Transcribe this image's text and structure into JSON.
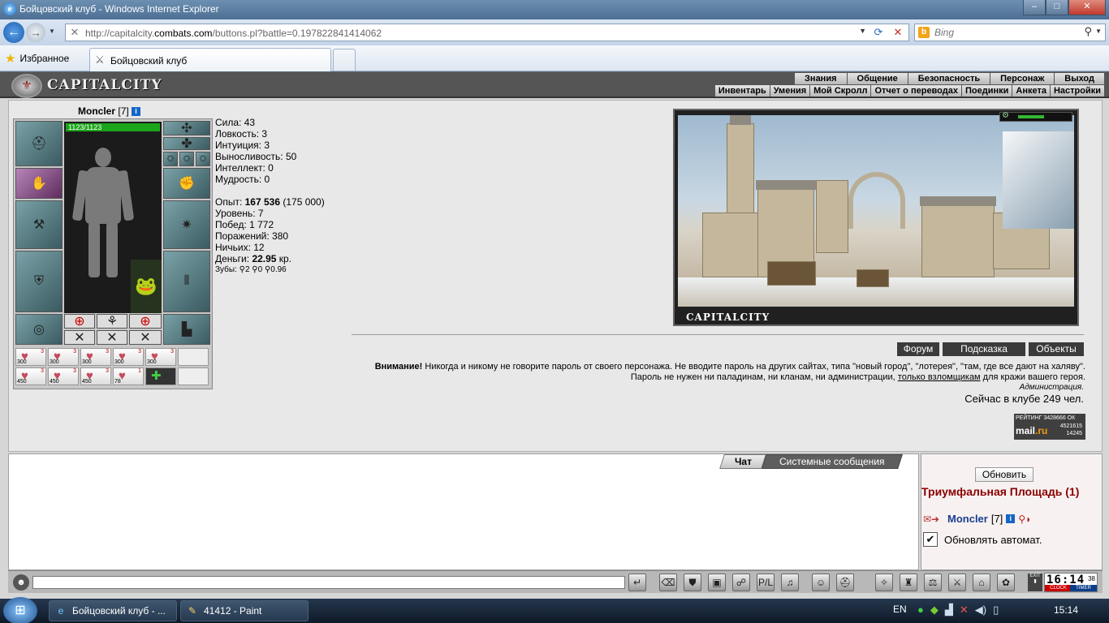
{
  "window": {
    "title": "Бойцовский клуб - Windows Internet Explorer",
    "controls": {
      "min": "–",
      "max": "□",
      "close": "✕"
    }
  },
  "address": {
    "url_pre": "http://capitalcity.",
    "url_host": "combats.com",
    "url_post": "/buttons.pl?battle=0.197822841414062",
    "search_placeholder": "Bing"
  },
  "favorites": {
    "label": "Избранное"
  },
  "tab": {
    "label": "Бойцовский клуб"
  },
  "game": {
    "logo": "CAPITALCITY",
    "top_menu": [
      "Знания",
      "Общение",
      "Безопасность",
      "Персонаж",
      "Выход"
    ],
    "sub_menu": [
      "Инвентарь",
      "Умения",
      "Мой Скролл",
      "Отчет о переводах",
      "Поединки",
      "Анкета",
      "Настройки"
    ]
  },
  "character": {
    "name": "Moncler",
    "level": "[7]",
    "hp": "1123/1123"
  },
  "stats": {
    "strength": "Сила: 43",
    "agility": "Ловкость: 3",
    "intuition": "Интуиция: 3",
    "stamina": "Выносливость: 50",
    "intellect": "Интеллект: 0",
    "wisdom": "Мудрость: 0",
    "exp_label": "Опыт: ",
    "exp_value": "167 536",
    "exp_next": " (175 000)",
    "level": "Уровень: 7",
    "wins": "Побед: 1 772",
    "losses": "Поражений: 380",
    "draws": "Ничьих: 12",
    "money_label": "Деньги: ",
    "money_value": "22.95",
    "money_unit": " кр.",
    "teeth": "Зубы: ⚲2 ⚲0 ⚲0.96"
  },
  "potions": [
    {
      "count": "3",
      "lvl": "300"
    },
    {
      "count": "3",
      "lvl": "300"
    },
    {
      "count": "3",
      "lvl": "300"
    },
    {
      "count": "3",
      "lvl": "300"
    },
    {
      "count": "3",
      "lvl": "300"
    },
    {
      "count": "3",
      "lvl": "450"
    },
    {
      "count": "3",
      "lvl": "450"
    },
    {
      "count": "3",
      "lvl": "450"
    },
    {
      "count": "1",
      "lvl": "78"
    }
  ],
  "location": {
    "label": "CAPITALCITY"
  },
  "links": [
    "Форум",
    "Подсказка",
    "Объекты"
  ],
  "warning": {
    "bold": "Внимание!",
    "text1": " Никогда и никому не говорите пароль от своего персонажа. Не вводите пароль на других сайтах, типа \"новый город\", \"лотерея\", \"там, где все дают на халяву\". Пароль не нужен ни паладинам, ни кланам, ни администрации, ",
    "link": "только взломщикам",
    "text2": " для кражи вашего героя.",
    "sign": "Администрация."
  },
  "online": "Сейчас в клубе 249 чел.",
  "rating": {
    "title": "РЕЙТИНГ 3428666 ОК",
    "v1": "4521615",
    "v2": "14245",
    "logo_a": "mail",
    "logo_b": ".ru"
  },
  "chat": {
    "tab_chat": "Чат",
    "tab_system": "Системные сообщения"
  },
  "room": {
    "refresh": "Обновить",
    "name": "Триумфальная Площадь (1)",
    "user_name": "Moncler",
    "user_level": "[7]",
    "auto_update": "Обновлять автомат."
  },
  "clock": {
    "time": "16:14",
    "secs": "38",
    "clock_label": "CLOCK",
    "timer_label": "TIMER",
    "exit": "EXIT"
  },
  "taskbar": {
    "items": [
      "Бойцовский клуб - ...",
      "41412 - Paint"
    ],
    "lang": "EN",
    "time": "15:14"
  }
}
